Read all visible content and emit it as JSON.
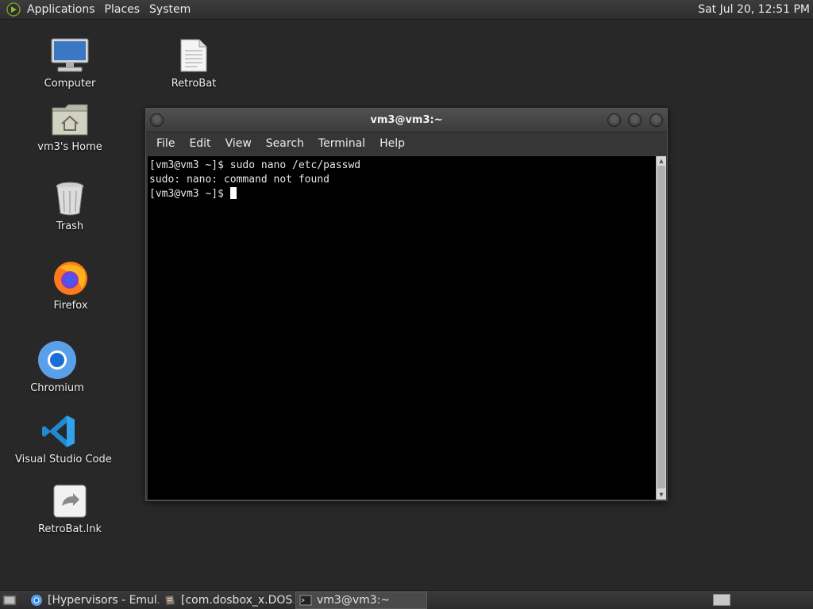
{
  "top_panel": {
    "menus": [
      "Applications",
      "Places",
      "System"
    ],
    "clock": "Sat Jul 20, 12:51 PM"
  },
  "desktop_icons": [
    {
      "label": "Computer",
      "icon": "computer-icon"
    },
    {
      "label": "RetroBat",
      "icon": "text-file-icon"
    },
    {
      "label": "vm3's Home",
      "icon": "home-folder-icon"
    },
    {
      "label": "Trash",
      "icon": "trash-icon"
    },
    {
      "label": "Firefox",
      "icon": "firefox-icon"
    },
    {
      "label": "Chromium",
      "icon": "chromium-icon"
    },
    {
      "label": "Visual Studio Code",
      "icon": "vscode-icon"
    },
    {
      "label": "RetroBat.lnk",
      "icon": "shortcut-file-icon"
    }
  ],
  "terminal": {
    "title": "vm3@vm3:~",
    "menus": [
      "File",
      "Edit",
      "View",
      "Search",
      "Terminal",
      "Help"
    ],
    "lines": [
      "[vm3@vm3 ~]$ sudo nano /etc/passwd",
      "sudo: nano: command not found",
      "[vm3@vm3 ~]$ "
    ]
  },
  "taskbar": {
    "tasks": [
      {
        "label": "[Hypervisors - Emul...",
        "icon": "chromium-icon",
        "active": false
      },
      {
        "label": "[com.dosbox_x.DOS...",
        "icon": "app-icon",
        "active": false
      },
      {
        "label": "vm3@vm3:~",
        "icon": "terminal-icon",
        "active": true
      }
    ]
  }
}
